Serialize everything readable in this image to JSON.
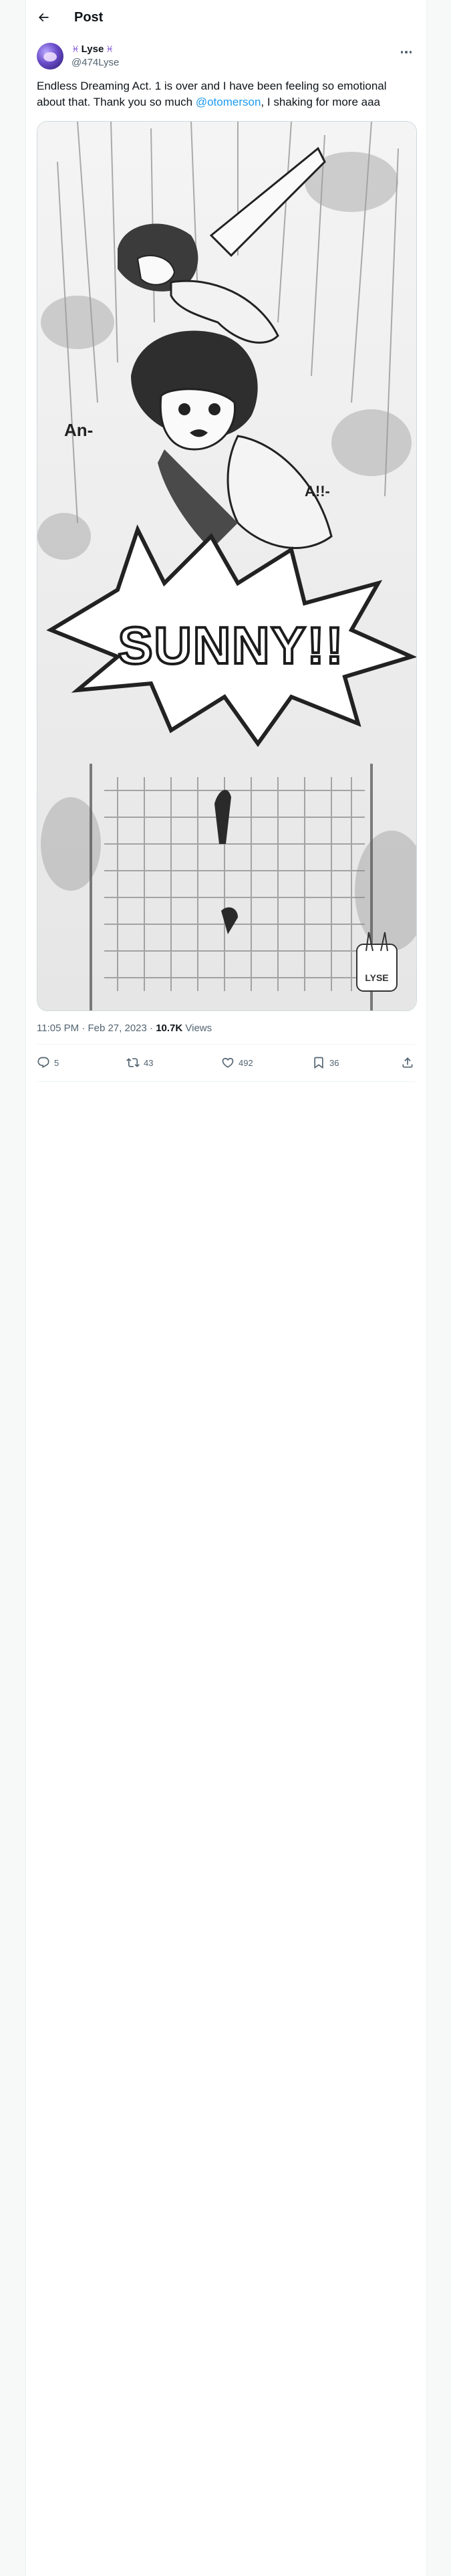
{
  "header": {
    "title": "Post"
  },
  "author": {
    "display_name": "Lyse",
    "emoji_left": "♓",
    "emoji_right": "♓",
    "handle": "@474Lyse"
  },
  "tweet": {
    "text_before": "Endless Dreaming Act. 1 is over and I have been feeling so emotional about that. Thank you so much ",
    "mention": "@otomerson",
    "text_after": ", I shaking for more aaa"
  },
  "media": {
    "type": "illustration",
    "sfx_main": "SUNNY!!",
    "sfx_left": "An-",
    "sfx_right": "A!!-",
    "signature": "LYSE"
  },
  "meta": {
    "time": "11:05 PM",
    "date": "Feb 27, 2023",
    "views_count": "10.7K",
    "views_label": "Views",
    "separator": "·"
  },
  "actions": {
    "replies": "5",
    "reposts": "43",
    "likes": "492",
    "bookmarks": "36"
  }
}
